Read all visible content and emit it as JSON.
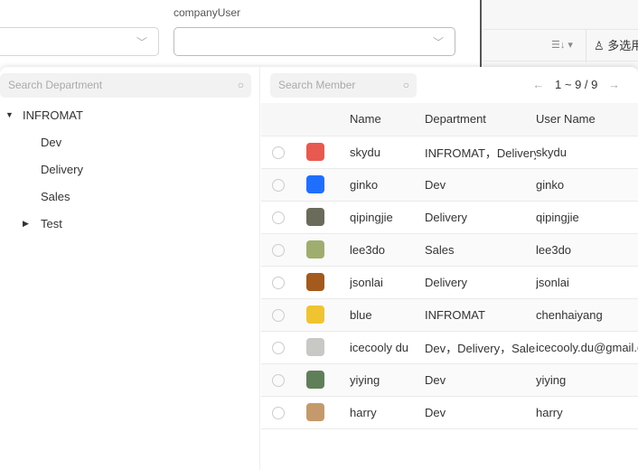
{
  "background_form": {
    "field_label": "companyUser",
    "table_header": "多选用",
    "sort_icon": "sort-icon"
  },
  "departments": {
    "search_placeholder": "Search Department",
    "root": "INFROMAT",
    "children": [
      "Dev",
      "Delivery",
      "Sales",
      "Test"
    ]
  },
  "members": {
    "search_placeholder": "Search Member",
    "pagination": "1 ~ 9 / 9",
    "columns": [
      "Name",
      "Department",
      "User Name"
    ],
    "rows": [
      {
        "name": "skydu",
        "department": "INFROMAT，Delivery",
        "username": "skydu",
        "avatar": "#e85a4f"
      },
      {
        "name": "ginko",
        "department": "Dev",
        "username": "ginko",
        "avatar": "#1f6fff"
      },
      {
        "name": "qipingjie",
        "department": "Delivery",
        "username": "qipingjie",
        "avatar": "#6b6b5c"
      },
      {
        "name": "lee3do",
        "department": "Sales",
        "username": "lee3do",
        "avatar": "#9fae6e"
      },
      {
        "name": "jsonlai",
        "department": "Delivery",
        "username": "jsonlai",
        "avatar": "#a35a1c"
      },
      {
        "name": "blue",
        "department": "INFROMAT",
        "username": "chenhaiyang",
        "avatar": "#f0c430"
      },
      {
        "name": "icecooly du",
        "department": "Dev，Delivery，Sales",
        "username": "icecooly.du@gmail.com",
        "avatar": "#c8c8c4"
      },
      {
        "name": "yiying",
        "department": "Dev",
        "username": "yiying",
        "avatar": "#5f7f59"
      },
      {
        "name": "harry",
        "department": "Dev",
        "username": "harry",
        "avatar": "#c49a6c"
      }
    ]
  }
}
